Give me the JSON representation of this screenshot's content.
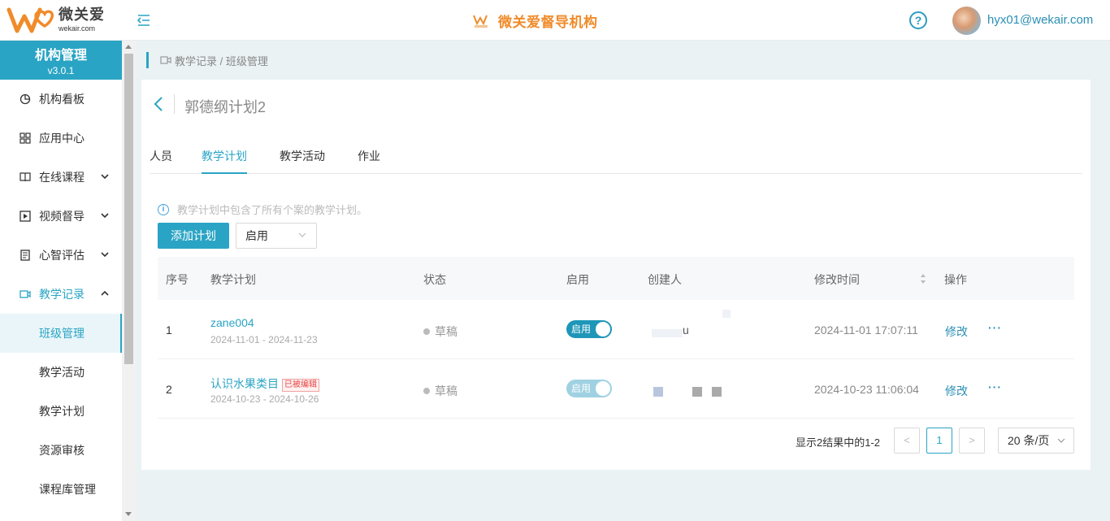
{
  "header": {
    "logo_cn": "微关爱",
    "logo_en": "wekair.com",
    "brand_title": "微关爱督导机构",
    "help_icon": "?",
    "user_email": "hyx01@wekair.com"
  },
  "sidebar": {
    "title": "机构管理",
    "version": "v3.0.1",
    "items": [
      {
        "label": "机构看板",
        "icon": "pie-chart-icon"
      },
      {
        "label": "应用中心",
        "icon": "grid-icon"
      },
      {
        "label": "在线课程",
        "icon": "book-icon",
        "expandable": true
      },
      {
        "label": "视频督导",
        "icon": "play-icon",
        "expandable": true
      },
      {
        "label": "心智评估",
        "icon": "clipboard-icon",
        "expandable": true
      },
      {
        "label": "教学记录",
        "icon": "video-icon",
        "expandable": true,
        "expanded": true
      }
    ],
    "sub_items": [
      "班级管理",
      "教学活动",
      "教学计划",
      "资源审核",
      "课程库管理"
    ],
    "active_sub": "班级管理"
  },
  "breadcrumb": "教学记录 / 班级管理",
  "page": {
    "title": "郭德纲计划2",
    "tabs": [
      "人员",
      "教学计划",
      "教学活动",
      "作业"
    ],
    "active_tab": "教学计划",
    "info_text": "教学计划中包含了所有个案的教学计划。",
    "add_button": "添加计划",
    "filter_value": "启用"
  },
  "table": {
    "columns": [
      "序号",
      "教学计划",
      "状态",
      "启用",
      "创建人",
      "修改时间",
      "操作"
    ],
    "rows": [
      {
        "index": "1",
        "name": "zane004",
        "date_range": "2024-11-01 - 2024-11-23",
        "tag": "",
        "status": "草稿",
        "enabled_label": "启用",
        "enabled_disabled": false,
        "creator": "u",
        "modified": "2024-11-01 17:07:11",
        "edit": "修改",
        "more": "···"
      },
      {
        "index": "2",
        "name": "认识水果类目",
        "date_range": "2024-10-23 - 2024-10-26",
        "tag": "已被编辑",
        "status": "草稿",
        "enabled_label": "启用",
        "enabled_disabled": true,
        "creator": "",
        "modified": "2024-10-23 11:06:04",
        "edit": "修改",
        "more": "···"
      }
    ]
  },
  "pagination": {
    "total_text": "显示2结果中的1-2",
    "prev": "<",
    "current": "1",
    "next": ">",
    "page_size": "20 条/页"
  },
  "colors": {
    "accent": "#2aa4c4",
    "brand_orange": "#f08b2a"
  }
}
